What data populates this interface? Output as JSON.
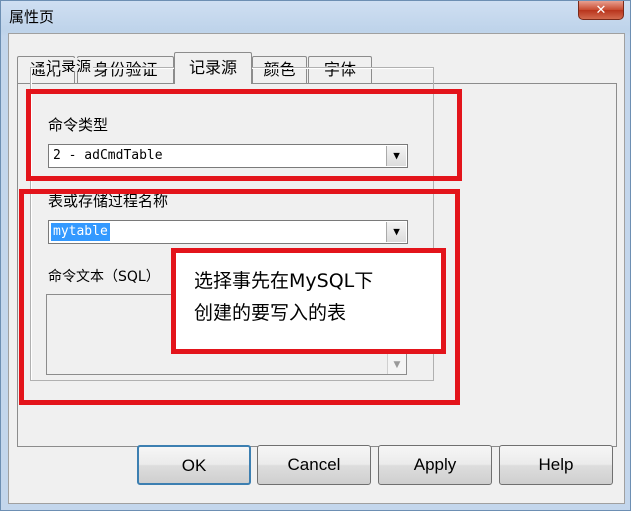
{
  "window": {
    "title": "属性页",
    "close_glyph": "✕"
  },
  "tabs": [
    {
      "label": "通用"
    },
    {
      "label": "身份验证"
    },
    {
      "label": "记录源"
    },
    {
      "label": "颜色"
    },
    {
      "label": "字体"
    }
  ],
  "active_tab": "记录源",
  "record_source": {
    "group_title": "记录源",
    "command_type_label": "命令类型",
    "command_type_value": "2 - adCmdTable",
    "table_label": "表或存储过程名称",
    "table_value": "mytable",
    "command_text_label": "命令文本（SQL）",
    "command_text_value": ""
  },
  "annotation": {
    "line1": "选择事先在MySQL下",
    "line2": "创建的要写入的表",
    "color": "#e3141b"
  },
  "buttons": {
    "ok": "OK",
    "cancel": "Cancel",
    "apply": "Apply",
    "help": "Help"
  }
}
